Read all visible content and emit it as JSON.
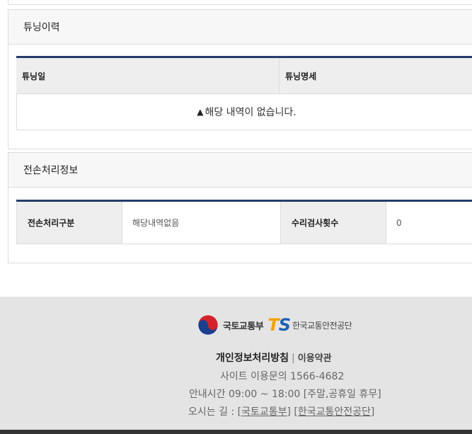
{
  "tuning": {
    "title": "튜닝이력",
    "columns": [
      "튜닝일",
      "튜닝명세"
    ],
    "empty_message": "해당 내역이 없습니다."
  },
  "loss": {
    "title": "전손처리정보",
    "label1": "전손처리구분",
    "value1": "해당내역없음",
    "label2": "수리검사횟수",
    "value2": "0"
  },
  "footer": {
    "ministry_name": "국토교통부",
    "ts_logo_t": "T",
    "ts_logo_s": "S",
    "agency_name": "한국교통안전공단",
    "privacy_policy": "개인정보처리방침",
    "separator": "|",
    "terms": "이용약관",
    "site_contact": "사이트 이용문의 1566-4682",
    "hours": "안내시간 09:00 ~ 18:00 [주말,공휴일 휴무]",
    "directions_label": "오시는 길 :",
    "directions_link1": "[국토교통부]",
    "directions_link2": "[한국교통안전공단]"
  },
  "colors": {
    "table_accent": "#263c6a",
    "ts_orange": "#f4a000",
    "ts_blue": "#1b63b6"
  }
}
